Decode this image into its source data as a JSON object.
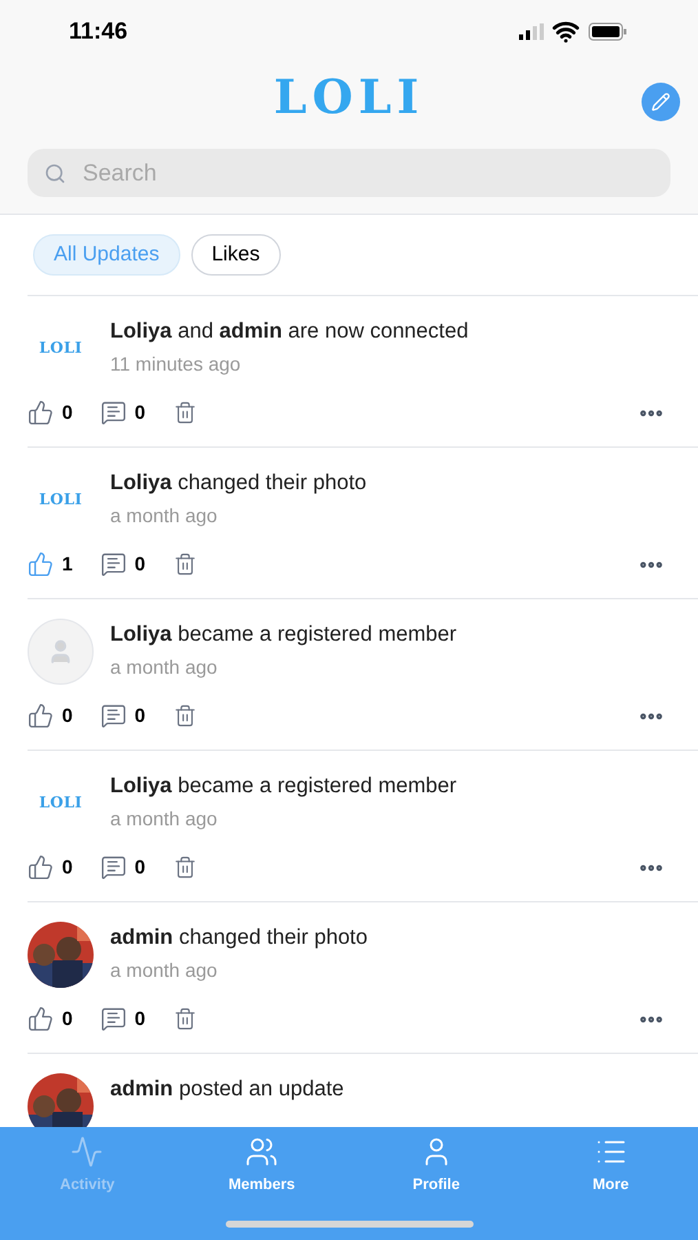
{
  "status_bar": {
    "time": "11:46"
  },
  "header": {
    "logo": "LOLI"
  },
  "search": {
    "placeholder": "Search"
  },
  "filters": [
    {
      "label": "All Updates",
      "selected": true
    },
    {
      "label": "Likes",
      "selected": false
    }
  ],
  "feed": [
    {
      "avatar": {
        "kind": "logo",
        "text": "LOLI"
      },
      "message": "**Loliya** and **admin** are now connected",
      "time": "11 minutes ago",
      "likes": "0",
      "liked": false,
      "comments": "0"
    },
    {
      "avatar": {
        "kind": "logo",
        "text": "LOLI"
      },
      "message": "**Loliya** changed their photo",
      "time": "a month ago",
      "likes": "1",
      "liked": true,
      "comments": "0"
    },
    {
      "avatar": {
        "kind": "placeholder"
      },
      "message": "**Loliya** became a registered member",
      "time": "a month ago",
      "likes": "0",
      "liked": false,
      "comments": "0"
    },
    {
      "avatar": {
        "kind": "logo",
        "text": "LOLI"
      },
      "message": "**Loliya** became a registered member",
      "time": "a month ago",
      "likes": "0",
      "liked": false,
      "comments": "0"
    },
    {
      "message": "**admin** changed their photo",
      "time": "a month ago",
      "likes": "0",
      "liked": false,
      "comments": "0"
    },
    {
      "message": "**admin** posted an update"
    }
  ],
  "tab_bar": [
    {
      "label": "Activity",
      "selected": true
    },
    {
      "label": "Members",
      "selected": false
    },
    {
      "label": "Profile",
      "selected": false
    },
    {
      "label": "More",
      "selected": false
    }
  ]
}
